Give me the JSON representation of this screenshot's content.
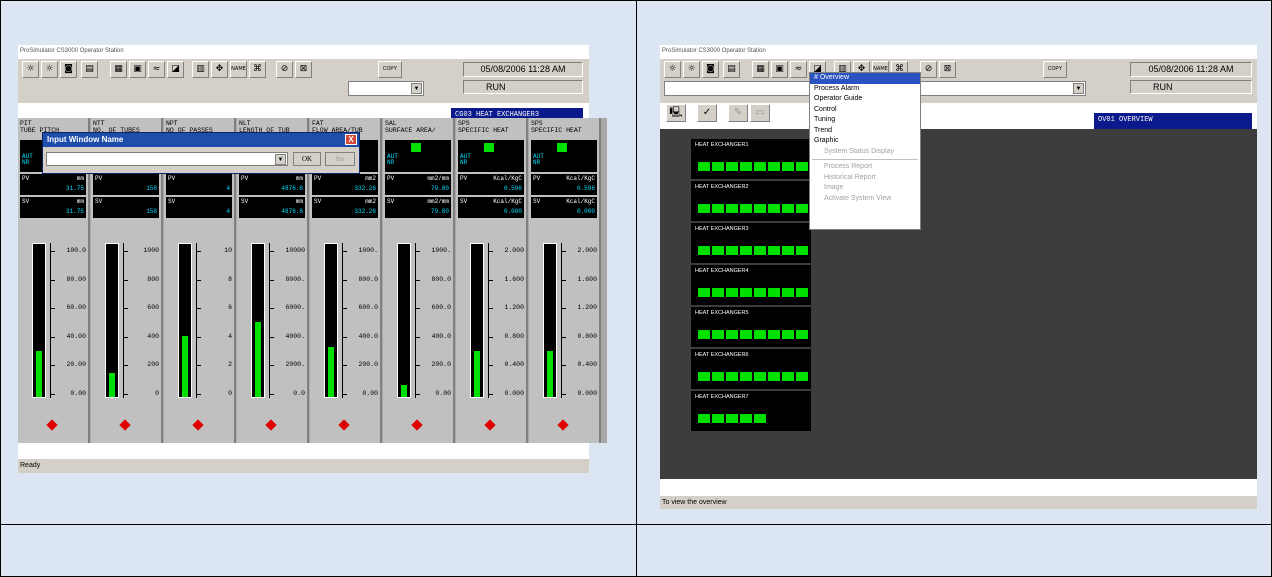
{
  "left": {
    "title": "ProSimulator CS3000 Operator Station",
    "datetime": "05/08/2006 11:28 AM",
    "run_status": "RUN",
    "copy_label": "COPY",
    "name_label": "NAME",
    "status": "Ready",
    "window_name": "CG03 HEAT EXCHANGER3",
    "dialog": {
      "title": "Input Window Name",
      "ok": "OK",
      "stn": "Stn",
      "close": "X"
    },
    "faceplates": [
      {
        "tag": "PIT",
        "desc": "TUBE PITCH",
        "mode": "AUT",
        "sub": "NR",
        "pv_unit": "mm",
        "pv": "31.75",
        "sv_unit": "mm",
        "sv": "31.75",
        "scale": [
          "100.0",
          "80.00",
          "60.00",
          "40.00",
          "20.00",
          "0.00"
        ],
        "level": 0.3
      },
      {
        "tag": "NTT",
        "desc": "NO. OF TUBES",
        "mode": "AUT",
        "sub": "NR",
        "pv_unit": "",
        "pv": "158",
        "sv_unit": "",
        "sv": "158",
        "scale": [
          "1000",
          "800",
          "600",
          "400",
          "200",
          "0"
        ],
        "level": 0.16
      },
      {
        "tag": "NPT",
        "desc": "NO OF PASSES",
        "mode": "AUT",
        "sub": "NR",
        "pv_unit": "",
        "pv": "4",
        "sv_unit": "",
        "sv": "4",
        "scale": [
          "10",
          "8",
          "6",
          "4",
          "2",
          "0"
        ],
        "level": 0.4
      },
      {
        "tag": "NLT",
        "desc": "LENGTH OF TUB",
        "mode": "AUT",
        "sub": "NR",
        "pv_unit": "mm",
        "pv": "4876.8",
        "sv_unit": "mm",
        "sv": "4876.8",
        "scale": [
          "10000",
          "8000.",
          "6000.",
          "4000.",
          "2000.",
          "0.0"
        ],
        "level": 0.49
      },
      {
        "tag": "FAT",
        "desc": "FLOW AREA/TUB",
        "mode": "AUT",
        "sub": "NR",
        "pv_unit": "mm2",
        "pv": "332.26",
        "sv_unit": "mm2",
        "sv": "332.26",
        "scale": [
          "1000.",
          "800.0",
          "600.0",
          "400.0",
          "200.0",
          "0.00"
        ],
        "level": 0.33
      },
      {
        "tag": "SAL",
        "desc": "SURFACE AREA/",
        "mode": "AUT",
        "sub": "NR",
        "pv_unit": "mm2/mm",
        "pv": "79.80",
        "sv_unit": "mm2/mm",
        "sv": "79.80",
        "scale": [
          "1000.",
          "800.0",
          "600.0",
          "400.0",
          "200.0",
          "0.00"
        ],
        "level": 0.08
      },
      {
        "tag": "SPS",
        "desc": "SPECIFIC HEAT",
        "mode": "AUT",
        "sub": "NR",
        "pv_unit": "Kcal/KgC",
        "pv": "0.596",
        "sv_unit": "Kcal/KgC",
        "sv": "0.000",
        "scale": [
          "2.000",
          "1.600",
          "1.200",
          "0.800",
          "0.400",
          "0.000"
        ],
        "level": 0.3
      },
      {
        "tag": "SPS",
        "desc": "SPECIFIC HEAT",
        "mode": "AUT",
        "sub": "NR",
        "pv_unit": "Kcal/KgC",
        "pv": "0.596",
        "sv_unit": "Kcal/KgC",
        "sv": "0.000",
        "scale": [
          "2.000",
          "1.600",
          "1.200",
          "0.800",
          "0.400",
          "0.000"
        ],
        "level": 0.3
      }
    ]
  },
  "right": {
    "title": "ProSimulator CS3000 Operator Station",
    "datetime": "05/08/2006 11:28 AM",
    "run_status": "RUN",
    "copy_label": "COPY",
    "name_label": "NAME",
    "status": "To view the overview",
    "window_name": "OV01 OVERVIEW",
    "menu": {
      "items": [
        {
          "label": "# Overview",
          "state": "highlight"
        },
        {
          "label": "Process Alarm",
          "state": "normal"
        },
        {
          "label": "Operator Guide",
          "state": "normal"
        },
        {
          "label": "Control",
          "state": "normal"
        },
        {
          "label": "Tuning",
          "state": "normal"
        },
        {
          "label": "Trend",
          "state": "normal"
        },
        {
          "label": "Graphic",
          "state": "normal"
        },
        {
          "label": "System Status Display",
          "state": "disabled"
        }
      ],
      "items2": [
        {
          "label": "Process Report",
          "state": "disabled"
        },
        {
          "label": "Historical Report",
          "state": "disabled"
        },
        {
          "label": "Image",
          "state": "disabled"
        },
        {
          "label": "Activate System View",
          "state": "disabled"
        }
      ]
    },
    "exchangers": [
      {
        "name": "HEAT EXCHANGER1",
        "count": 8
      },
      {
        "name": "HEAT EXCHANGER2",
        "count": 8
      },
      {
        "name": "HEAT EXCHANGER3",
        "count": 8
      },
      {
        "name": "HEAT EXCHANGER4",
        "count": 8
      },
      {
        "name": "HEAT EXCHANGER5",
        "count": 8
      },
      {
        "name": "HEAT EXCHANGER6",
        "count": 8
      },
      {
        "name": "HEAT EXCHANGER7",
        "count": 5
      }
    ]
  }
}
